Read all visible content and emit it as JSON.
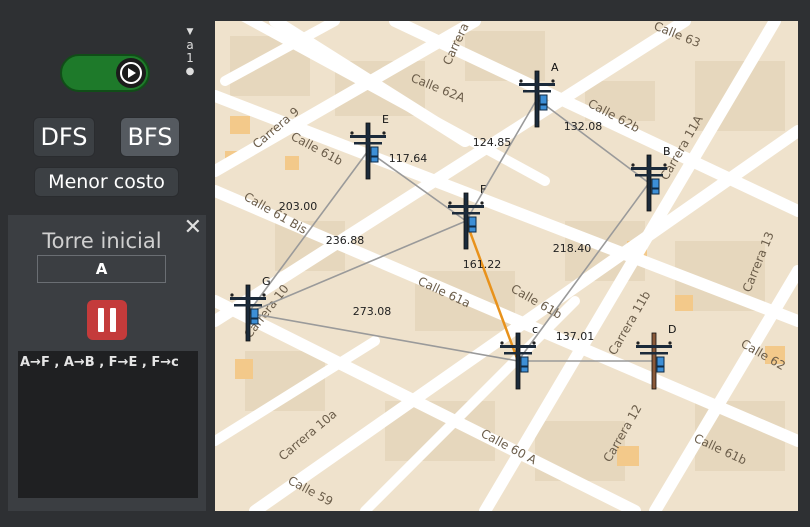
{
  "controls": {
    "dfs_label": "DFS",
    "bfs_label": "BFS",
    "cost_label": "Menor costo",
    "sort_icon_text": "a",
    "sort_icon_num": "1"
  },
  "start_panel": {
    "title": "Torre inicial",
    "value": "A",
    "close_symbol": "✕",
    "log": "A→F , A→B , F→E , F→c"
  },
  "map": {
    "streets": [
      "Carrera 9",
      "Calle 62A",
      "Carrera",
      "Calle 63",
      "Calle 62b",
      "Carrera 11A",
      "Calle 61b",
      "Calle 61 Bis",
      "Carrera 10",
      "Calle 61a",
      "Calle 61b",
      "Carrera 11b",
      "Carrera 13",
      "Calle 62",
      "Carrera 12",
      "Calle 61b",
      "Carrera 10a",
      "Calle 60 A",
      "Calle 59"
    ],
    "nodes": [
      "A",
      "B",
      "E",
      "F",
      "G",
      "C",
      "D"
    ],
    "edges": [
      {
        "from": "A",
        "to": "F",
        "cost": "124.85",
        "highlight": false
      },
      {
        "from": "A",
        "to": "B",
        "cost": "132.08",
        "highlight": false
      },
      {
        "from": "E",
        "to": "F",
        "cost": "117.64",
        "highlight": false
      },
      {
        "from": "E",
        "to": "G",
        "cost": "203.00",
        "highlight": false
      },
      {
        "from": "F",
        "to": "G",
        "cost": "236.88",
        "highlight": false
      },
      {
        "from": "F",
        "to": "C",
        "cost": "161.22",
        "highlight": true
      },
      {
        "from": "B",
        "to": "C",
        "cost": "218.40",
        "highlight": false
      },
      {
        "from": "G",
        "to": "C",
        "cost": "273.08",
        "highlight": false
      },
      {
        "from": "C",
        "to": "D",
        "cost": "137.01",
        "highlight": false
      }
    ],
    "colors": {
      "edge": "#9a9a9a",
      "highlight": "#e8921c",
      "tower": "#1b2a3a",
      "box": "#3d8fd6",
      "ground": "#efe2cc",
      "road": "#ffffff",
      "block": "#e3d3b8"
    }
  }
}
